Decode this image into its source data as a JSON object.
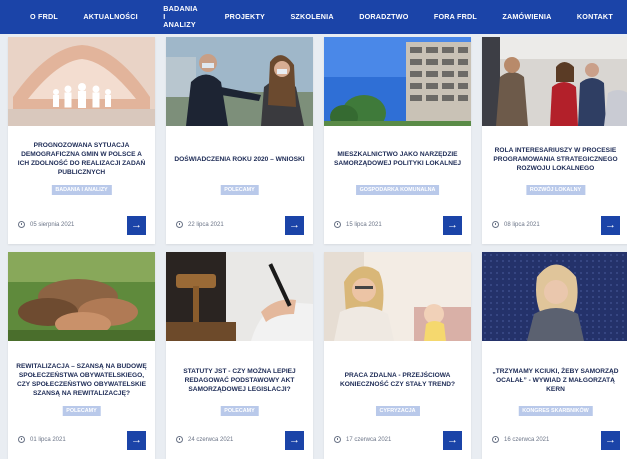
{
  "nav": {
    "items": [
      {
        "label": "O FRDL"
      },
      {
        "label": "AKTUALNOŚCI"
      },
      {
        "label": "BADANIA I ANALIZY"
      },
      {
        "label": "PROJEKTY"
      },
      {
        "label": "SZKOLENIA"
      },
      {
        "label": "DORADZTWO"
      },
      {
        "label": "FORA FRDL"
      },
      {
        "label": "ZAMÓWIENIA"
      },
      {
        "label": "KONTAKT"
      }
    ]
  },
  "articles": [
    {
      "title": "PROGNOZOWANA SYTUACJA DEMOGRAFICZNA GMIN W POLSCE A ICH ZDOLNOŚĆ DO REALIZACJI ZADAŃ PUBLICZNYCH",
      "tag": "BADANIA I ANALIZY",
      "date": "05 sierpnia 2021"
    },
    {
      "title": "DOŚWIADCZENIA ROKU 2020 – WNIOSKI",
      "tag": "POLECAMY",
      "date": "22 lipca 2021"
    },
    {
      "title": "MIESZKALNICTWO JAKO NARZĘDZIE SAMORZĄDOWEJ POLITYKI LOKALNEJ",
      "tag": "GOSPODARKA KOMUNALNA",
      "date": "15 lipca 2021"
    },
    {
      "title": "ROLA INTERESARIUSZY W PROCESIE PROGRAMOWANIA STRATEGICZNEGO ROZWOJU LOKALNEGO",
      "tag": "ROZWÓJ LOKALNY",
      "date": "08 lipca 2021"
    },
    {
      "title": "REWITALIZACJA – SZANSĄ NA BUDOWĘ SPOŁECZEŃSTWA OBYWATELSKIEGO, CZY SPOŁECZEŃSTWO OBYWATELSKIE SZANSĄ NA REWITALIZACJĘ?",
      "tag": "POLECAMY",
      "date": "01 lipca 2021"
    },
    {
      "title": "STATUTY JST - CZY MOŻNA LEPIEJ REDAGOWAĆ PODSTAWOWY AKT SAMORZĄDOWEJ LEGISLACJI?",
      "tag": "POLECAMY",
      "date": "24 czerwca 2021"
    },
    {
      "title": "PRACA ZDALNA - PRZEJŚCIOWA KONIECZNOŚĆ CZY STAŁY TREND?",
      "tag": "CYFRYZACJA",
      "date": "17 czerwca 2021"
    },
    {
      "title": "„TRZYMAMY KCIUKI, ŻEBY SAMORZĄD OCALAŁ” - WYWIAD Z MAŁGORZATĄ KERN",
      "tag": "KONGRES SKARBNIKÓW",
      "date": "16 czerwca 2021"
    }
  ],
  "icons": {
    "date": "clock-icon",
    "read_more": "arrow-right-icon"
  },
  "colors": {
    "nav_bg": "#1b44a8",
    "tag_bg": "#b9c9ea",
    "title_text": "#1c2a55",
    "button_bg": "#1b44a8"
  }
}
